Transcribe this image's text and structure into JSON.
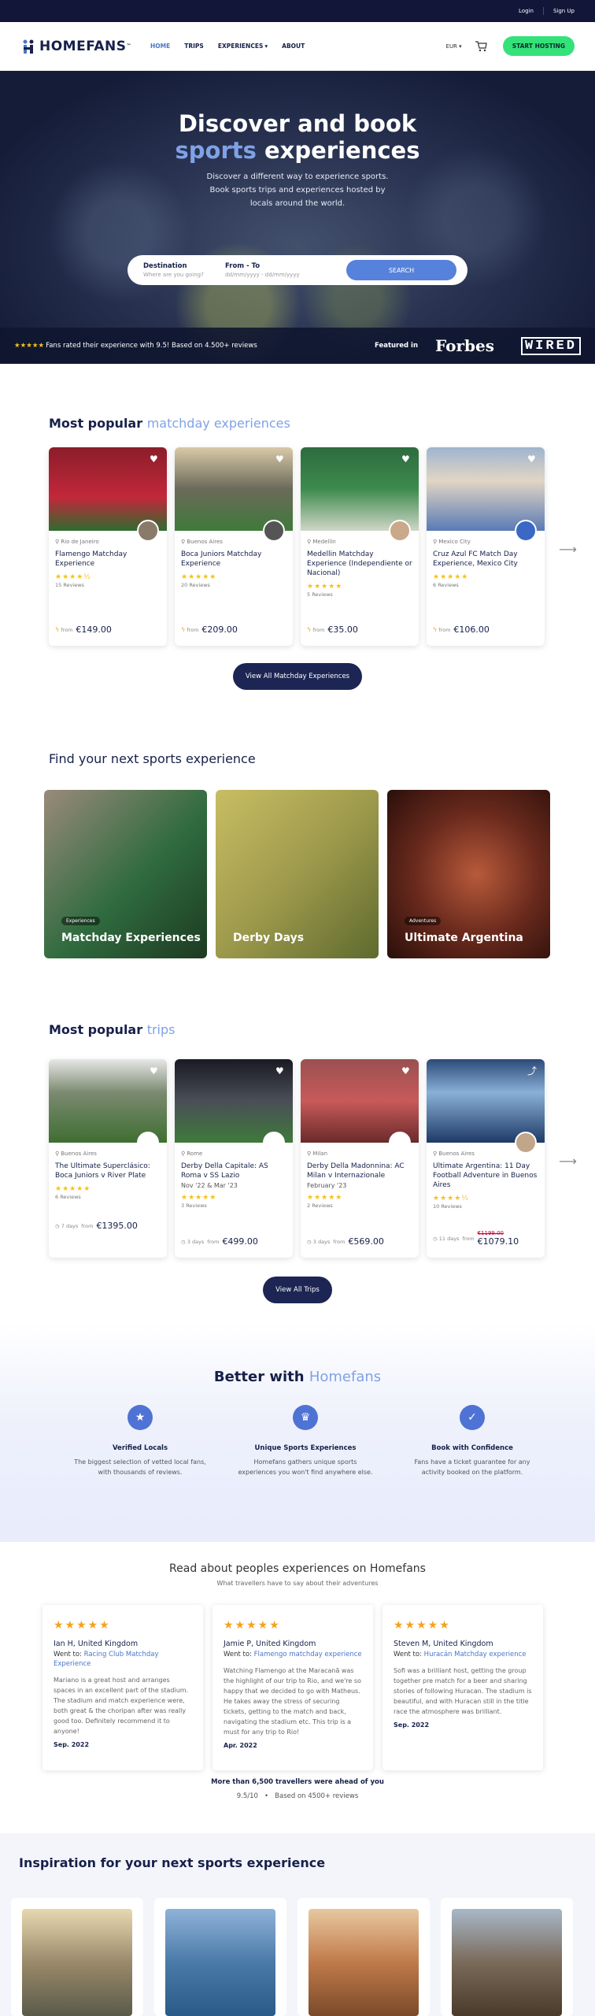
{
  "topbar": {
    "login": "Login",
    "signup": "Sign Up"
  },
  "nav": {
    "logo": "HOMEFANS",
    "logo_tm": "™",
    "items": [
      "HOME",
      "TRIPS",
      "EXPERIENCES",
      "ABOUT"
    ],
    "currency": "EUR",
    "host_btn": "START HOSTING"
  },
  "hero": {
    "title_1": "Discover and book",
    "title_blue": "sports",
    "title_2": "experiences",
    "desc_1": "Discover a different way to experience sports.",
    "desc_2": "Book sports trips and experiences hosted by",
    "desc_3": "locals around the world.",
    "dest_label": "Destination",
    "dest_placeholder": "Where are you going?",
    "date_label": "From - To",
    "date_placeholder": "dd/mm/yyyy - dd/mm/yyyy",
    "search_btn": "SEARCH",
    "rating_stars": "★★★★★",
    "rating_text": "Fans rated their experience with 9.5! Based on 4.500+ reviews",
    "featured_label": "Featured in",
    "forbes": "Forbes",
    "wired": "WIRED"
  },
  "matchday": {
    "title": "Most popular",
    "title_blue": "matchday experiences",
    "view_all": "View All Matchday Experiences",
    "cards": [
      {
        "loc": "Rio de Janeiro",
        "title": "Flamengo Matchday Experience",
        "stars": "★★★★½",
        "reviews": "15 Reviews",
        "from": "from",
        "price": "€149.00"
      },
      {
        "loc": "Buenos Aires",
        "title": "Boca Juniors Matchday Experience",
        "stars": "★★★★★",
        "reviews": "20 Reviews",
        "from": "from",
        "price": "€209.00"
      },
      {
        "loc": "Medellin",
        "title": "Medellin Matchday Experience (Independiente or Nacional)",
        "stars": "★★★★★",
        "reviews": "5 Reviews",
        "from": "from",
        "price": "€35.00"
      },
      {
        "loc": "Mexico City",
        "title": "Cruz Azul FC Match Day Experience, Mexico City",
        "stars": "★★★★★",
        "reviews": "6 Reviews",
        "from": "from",
        "price": "€106.00"
      }
    ]
  },
  "find": {
    "title": "Find your next sports experience",
    "tiles": [
      {
        "tag": "Experiences",
        "name": "Matchday Experiences"
      },
      {
        "tag": "",
        "name": "Derby Days"
      },
      {
        "tag": "Adventures",
        "name": "Ultimate Argentina"
      }
    ]
  },
  "trips": {
    "title": "Most popular",
    "title_blue": "trips",
    "view_all": "View All Trips",
    "cards": [
      {
        "loc": "Buenos Aires",
        "title": "The Ultimate Superclásico: Boca Juniors v River Plate",
        "date": "",
        "stars": "★★★★★",
        "reviews": "6 Reviews",
        "days": "7 days",
        "from": "from",
        "price": "€1395.00",
        "old": ""
      },
      {
        "loc": "Rome",
        "title": "Derby Della Capitale: AS Roma v SS Lazio",
        "date": "Nov '22 & Mar '23",
        "stars": "★★★★★",
        "reviews": "3 Reviews",
        "days": "3 days",
        "from": "from",
        "price": "€499.00",
        "old": ""
      },
      {
        "loc": "Milan",
        "title": "Derby Della Madonnina: AC Milan v Internazionale",
        "date": "February '23",
        "stars": "★★★★★",
        "reviews": "2 Reviews",
        "days": "3 days",
        "from": "from",
        "price": "€569.00",
        "old": ""
      },
      {
        "loc": "Buenos Aires",
        "title": "Ultimate Argentina: 11 Day Football Adventure in Buenos Aires",
        "date": "",
        "stars": "★★★★½",
        "reviews": "10 Reviews",
        "days": "11 days",
        "from": "from",
        "price": "€1079.10",
        "old": "€1199.00"
      }
    ]
  },
  "better": {
    "title": "Better with",
    "title_blue": "Homefans",
    "features": [
      {
        "title": "Verified Locals",
        "text_1": "The biggest selection of vetted local fans,",
        "text_2": "with thousands of reviews."
      },
      {
        "title": "Unique Sports Experiences",
        "text_1": "Homefans gathers unique sports",
        "text_2": "experiences you won't find anywhere else."
      },
      {
        "title": "Book with Confidence",
        "text_1": "Fans have a ticket guarantee for any",
        "text_2": "activity booked on the platform."
      }
    ]
  },
  "reviews": {
    "title": "Read about peoples experiences on Homefans",
    "subtitle": "What travellers have to say about their adventures",
    "items": [
      {
        "stars": "★★★★★",
        "name": "Ian H, United Kingdom",
        "went": "Went to:",
        "exp": "Racing Club Matchday Experience",
        "text": "Mariano is a great host and arranges spaces in an excellent part of the stadium. The stadium and match experience were, both great & the choripan after was really good too. Definitely recommend it to anyone!",
        "date": "Sep. 2022"
      },
      {
        "stars": "★★★★★",
        "name": "Jamie P, United Kingdom",
        "went": "Went to:",
        "exp": "Flamengo matchday experience",
        "text": "Watching Flamengo at the Maracanã was the highlight of our trip to Rio, and we're so happy that we decided to go with Matheus. He takes away the stress of securing tickets, getting to the match and back, navigating the stadium etc. This trip is a must for any trip to Rio!",
        "date": "Apr. 2022"
      },
      {
        "stars": "★★★★★",
        "name": "Steven M, United Kingdom",
        "went": "Went to:",
        "exp": "Huracán Matchday experience",
        "text": "Sofi was a brilliant host, getting the group together pre match for a beer and sharing stories of following Huracan. The stadium is beautiful, and with Huracan still in the title race the atmosphere was brilliant.",
        "date": "Sep. 2022"
      }
    ],
    "ahead": "More than 6,500 travellers were ahead of you",
    "score": "9.5/10",
    "score_sep": "•",
    "score_text": "Based on 4500+ reviews"
  },
  "inspo": {
    "title": "Inspiration for your next sports experience"
  }
}
